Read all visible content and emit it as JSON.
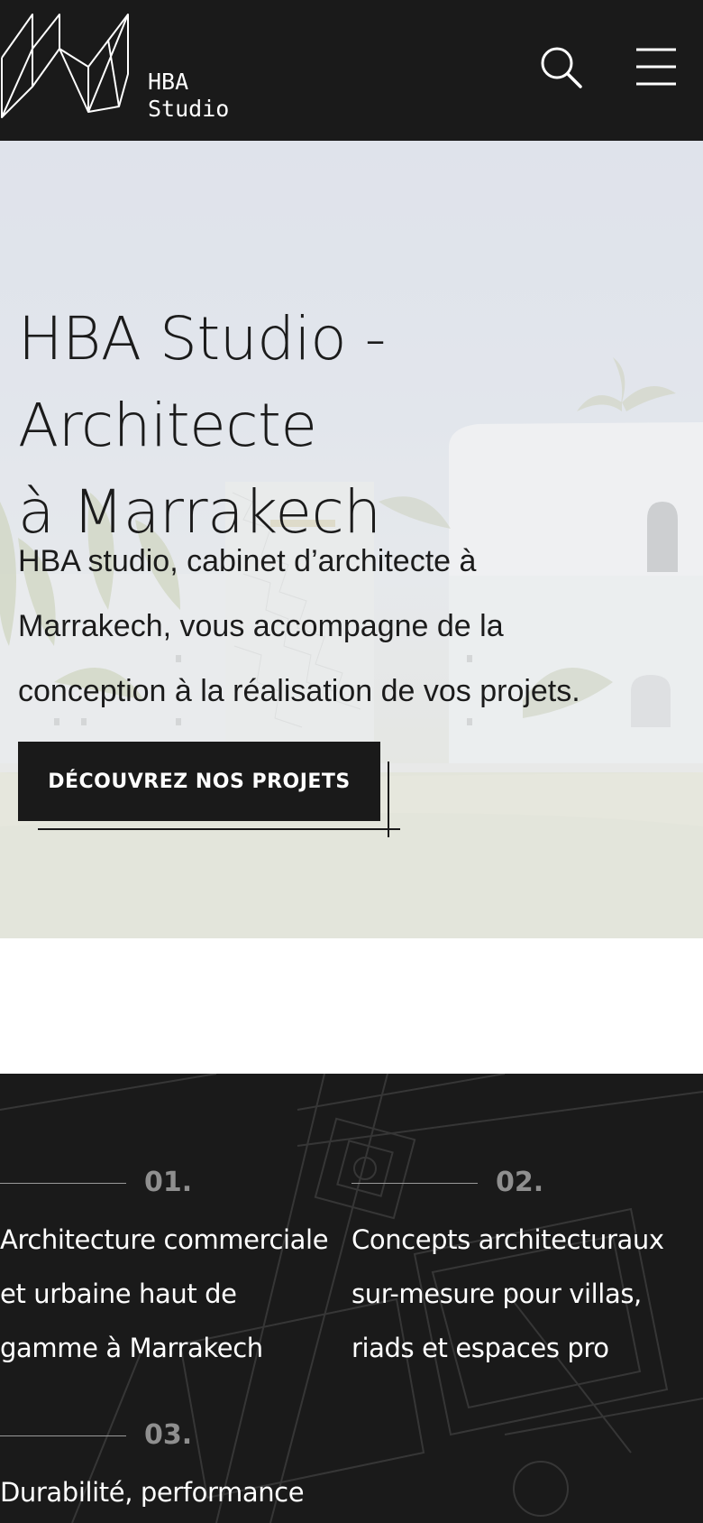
{
  "header": {
    "brand_line1": "HBA",
    "brand_line2": "Studio",
    "logo_icon": "hba-logo-icon",
    "search_icon": "search-icon",
    "menu_icon": "hamburger-menu-icon",
    "background_color": "#1a1a1a"
  },
  "hero": {
    "title_line1": "HBA Studio - Architecte",
    "title_line2": "à Marrakech",
    "subtitle_line1": "HBA studio, cabinet d’architecte à",
    "subtitle_line2": "Marrakech, vous accompagne de la",
    "subtitle_line3": "conception à la réalisation de vos projets.",
    "cta_label": "DÉCOUVREZ NOS PROJETS"
  },
  "features": {
    "items": [
      {
        "number": "01.",
        "lines": [
          "Architecture commerciale",
          "et urbaine haut de",
          "gamme à Marrakech"
        ]
      },
      {
        "number": "02.",
        "lines": [
          "Concepts architecturaux",
          "sur-mesure pour villas,",
          "riads et espaces pro"
        ]
      },
      {
        "number": "03.",
        "lines": [
          "Durabilité, performance"
        ]
      }
    ]
  }
}
